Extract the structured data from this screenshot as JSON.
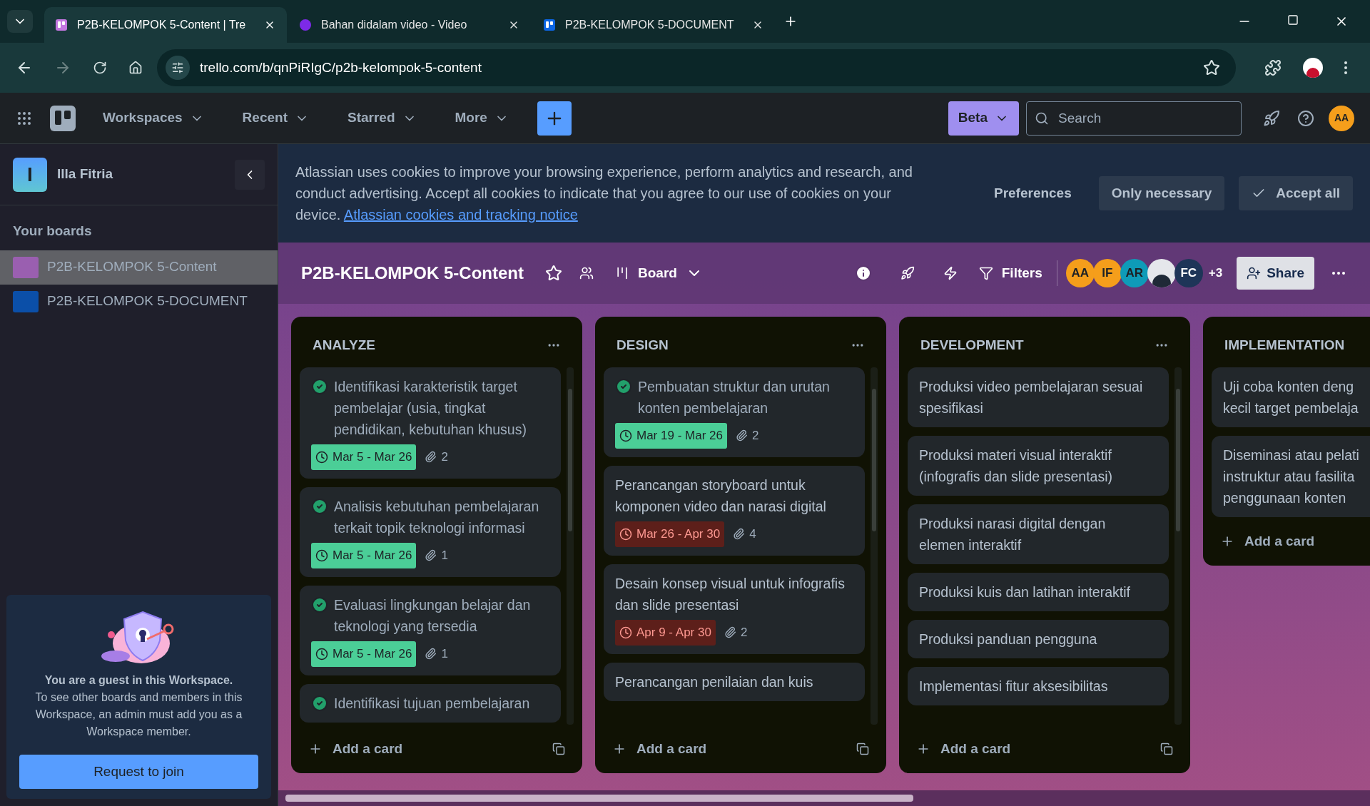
{
  "browser": {
    "tabs": [
      {
        "title": "P2B-KELOMPOK 5-Content | Tre",
        "kind": "board",
        "color": "#c377e0",
        "selected": true
      },
      {
        "title": "Bahan didalam video - Video",
        "kind": "design-app",
        "color": "#7d2ae8",
        "selected": false
      },
      {
        "title": "P2B-KELOMPOK 5-DOCUMENT",
        "kind": "board",
        "color": "#0c66e4",
        "selected": false
      }
    ],
    "url": "trello.com/b/qnPiRIgC/p2b-kelompok-5-content"
  },
  "nav": {
    "items": [
      "Workspaces",
      "Recent",
      "Starred",
      "More"
    ],
    "beta": "Beta",
    "search_placeholder": "Search",
    "avatar": "AA"
  },
  "sidebar": {
    "workspace_initial": "I",
    "workspace": "Illa Fitria",
    "boards_heading": "Your boards",
    "boards": [
      {
        "name": "P2B-KELOMPOK 5-Content",
        "color": "#9a5fb0",
        "selected": true
      },
      {
        "name": "P2B-KELOMPOK 5-DOCUMENT",
        "color": "#0b4fa8",
        "selected": false
      }
    ],
    "guest": {
      "title": "You are a guest in this Workspace.",
      "body": "To see other boards and members in this Workspace, an admin must add you as a Workspace member.",
      "button": "Request to join"
    }
  },
  "cookie_banner": {
    "text": "Atlassian uses cookies to improve your browsing experience, perform analytics and research, and conduct advertising. Accept all cookies to indicate that you agree to our use of cookies on your device.",
    "link": "Atlassian cookies and tracking notice",
    "buttons": [
      "Preferences",
      "Only necessary",
      "Accept all"
    ]
  },
  "board": {
    "title": "P2B-KELOMPOK 5-Content",
    "view": "Board",
    "filters": "Filters",
    "share": "Share",
    "more_members": "+3",
    "members": [
      {
        "initials": "AA",
        "kind": "initials",
        "color": "#f59e1b"
      },
      {
        "initials": "IF",
        "kind": "initials",
        "color": "#f59e1b"
      },
      {
        "initials": "AR",
        "kind": "initials",
        "color": "#0e9bb8"
      },
      {
        "kind": "photo",
        "color": "#e5e7eb"
      },
      {
        "initials": "FC",
        "kind": "initials",
        "color": "#1e3558"
      }
    ]
  },
  "lists": [
    {
      "title": "ANALYZE",
      "add": "Add a card",
      "cards": [
        {
          "lines": [
            "Identifikasi karakteristik target pembelajar (usia, tingkat pendidikan, kebutuhan khusus)"
          ],
          "done": true,
          "dates": "Mar 5 - Mar 26",
          "overdue": false,
          "attachments": "2"
        },
        {
          "lines": [
            "Analisis kebutuhan pembelajaran terkait topik teknologi informasi"
          ],
          "done": true,
          "dates": "Mar 5 - Mar 26",
          "overdue": false,
          "attachments": "1"
        },
        {
          "lines": [
            "Evaluasi lingkungan belajar dan teknologi yang tersedia"
          ],
          "done": true,
          "dates": "Mar 5 - Mar 26",
          "overdue": false,
          "attachments": "1"
        },
        {
          "lines": [
            "Identifikasi tujuan pembelajaran"
          ],
          "done": true
        }
      ]
    },
    {
      "title": "DESIGN",
      "add": "Add a card",
      "cards": [
        {
          "lines": [
            "Pembuatan struktur dan urutan konten pembelajaran"
          ],
          "done": true,
          "dates": "Mar 19 - Mar 26",
          "overdue": false,
          "attachments": "2"
        },
        {
          "lines": [
            "Perancangan storyboard untuk komponen video dan narasi digital"
          ],
          "done": false,
          "dates": "Mar 26 - Apr 30",
          "overdue": true,
          "attachments": "4"
        },
        {
          "lines": [
            "Desain konsep visual untuk infografis dan slide presentasi"
          ],
          "done": false,
          "dates": "Apr 9 - Apr 30",
          "overdue": true,
          "attachments": "2"
        },
        {
          "lines": [
            "Perancangan penilaian dan kuis"
          ],
          "done": false
        }
      ]
    },
    {
      "title": "DEVELOPMENT",
      "add": "Add a card",
      "cards": [
        {
          "lines": [
            "Produksi video pembelajaran sesuai spesifikasi"
          ],
          "done": false
        },
        {
          "lines": [
            "Produksi materi visual interaktif (infografis dan slide presentasi)"
          ],
          "done": false
        },
        {
          "lines": [
            "Produksi narasi digital dengan elemen interaktif"
          ],
          "done": false
        },
        {
          "lines": [
            "Produksi kuis dan latihan interaktif"
          ],
          "done": false
        },
        {
          "lines": [
            "Produksi panduan pengguna"
          ],
          "done": false
        },
        {
          "lines": [
            "Implementasi fitur aksesibilitas"
          ],
          "done": false
        }
      ]
    },
    {
      "title": "IMPLEMENTATION",
      "add": "Add a card",
      "cards": [
        {
          "lines": [
            "Uji coba konten deng",
            "kecil target pembelaja"
          ],
          "done": false
        },
        {
          "lines": [
            "Diseminasi atau pelati",
            "instruktur atau fasilita",
            "penggunaan konten"
          ],
          "done": false
        }
      ]
    }
  ]
}
